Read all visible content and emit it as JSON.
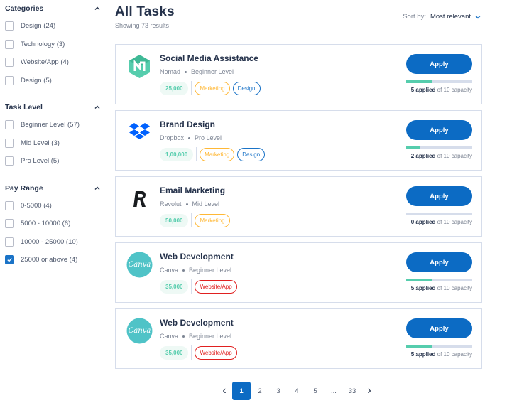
{
  "sidebar": {
    "groups": [
      {
        "title": "Categories",
        "options": [
          {
            "label": "Design (24)",
            "checked": false
          },
          {
            "label": "Technology (3)",
            "checked": false
          },
          {
            "label": "Website/App (4)",
            "checked": false
          },
          {
            "label": "Design (5)",
            "checked": false
          }
        ]
      },
      {
        "title": "Task Level",
        "options": [
          {
            "label": "Beginner Level (57)",
            "checked": false
          },
          {
            "label": "Mid Level (3)",
            "checked": false
          },
          {
            "label": "Pro Level (5)",
            "checked": false
          }
        ]
      },
      {
        "title": "Pay Range",
        "options": [
          {
            "label": "0-5000 (4)",
            "checked": false
          },
          {
            "label": "5000 - 10000 (6)",
            "checked": false
          },
          {
            "label": "10000 - 25000 (10)",
            "checked": false
          },
          {
            "label": "25000 or above (4)",
            "checked": true
          }
        ]
      }
    ]
  },
  "header": {
    "title": "All Tasks",
    "results": "Showing 73 results",
    "sort_label": "Sort by:",
    "sort_value": "Most relevant"
  },
  "tasks": [
    {
      "title": "Social Media Assistance",
      "company": "Nomad",
      "level": "Beginner Level",
      "pay": "25,000",
      "tags": [
        {
          "label": "Marketing",
          "kind": "marketing"
        },
        {
          "label": "Design",
          "kind": "design"
        }
      ],
      "apply_label": "Apply",
      "applied": "5 applied",
      "capacity": "of 10 capacity",
      "fill": 0.4,
      "logo": "nomad-logo"
    },
    {
      "title": "Brand Design",
      "company": "Dropbox",
      "level": "Pro Level",
      "pay": "1,00,000",
      "tags": [
        {
          "label": "Marketing",
          "kind": "marketing"
        },
        {
          "label": "Design",
          "kind": "design"
        }
      ],
      "apply_label": "Apply",
      "applied": "2 applied",
      "capacity": "of 10 capacity",
      "fill": 0.2,
      "logo": "dropbox-logo"
    },
    {
      "title": "Email Marketing",
      "company": "Revolut",
      "level": "Mid Level",
      "pay": "50,000",
      "tags": [
        {
          "label": "Marketing",
          "kind": "marketing"
        }
      ],
      "apply_label": "Apply",
      "applied": "0 applied",
      "capacity": "of 10 capacity",
      "fill": 0.0,
      "logo": "revolut-logo"
    },
    {
      "title": "Web Development",
      "company": "Canva",
      "level": "Beginner Level",
      "pay": "35,000",
      "tags": [
        {
          "label": "Website/App",
          "kind": "web"
        }
      ],
      "apply_label": "Apply",
      "applied": "5 applied",
      "capacity": "of 10 capacity",
      "fill": 0.4,
      "logo": "canva-logo"
    },
    {
      "title": "Web Development",
      "company": "Canva",
      "level": "Beginner Level",
      "pay": "35,000",
      "tags": [
        {
          "label": "Website/App",
          "kind": "web"
        }
      ],
      "apply_label": "Apply",
      "applied": "5 applied",
      "capacity": "of 10 capacity",
      "fill": 0.4,
      "logo": "canva-logo"
    }
  ],
  "logo_text": {
    "canva": "Canva"
  },
  "pagination": {
    "prev": "‹",
    "pages": [
      "1",
      "2",
      "3",
      "4",
      "5",
      "...",
      "33"
    ],
    "active": "1",
    "next": "›"
  },
  "colors": {
    "primary": "#0c6bc4",
    "progress": "#56cdad",
    "marketing": "#ffb836",
    "design": "#1a73c7",
    "web": "#e02020"
  }
}
